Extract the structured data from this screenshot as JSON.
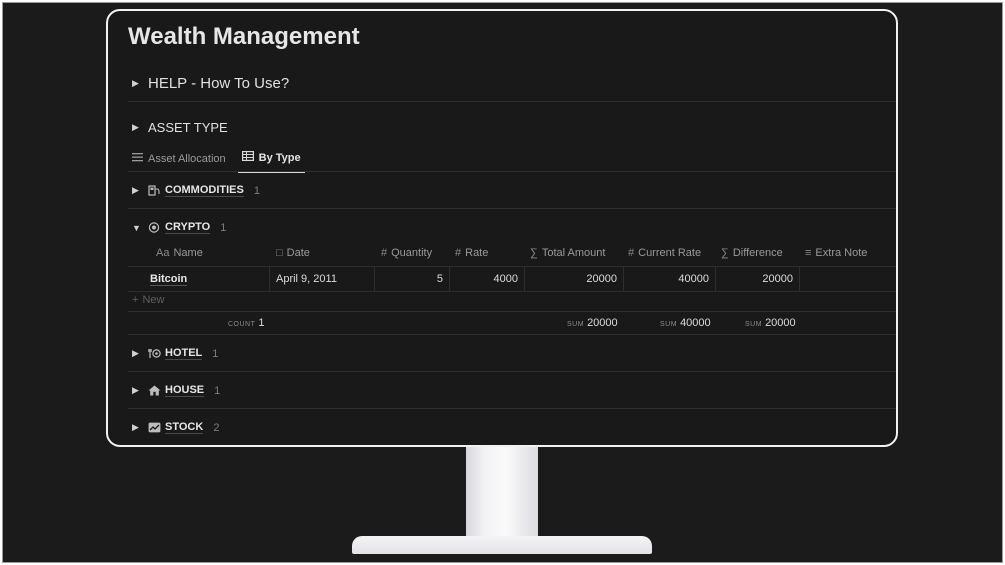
{
  "page": {
    "title": "Wealth Management"
  },
  "toggles": {
    "help": "HELP - How To Use?",
    "asset_type": "ASSET TYPE"
  },
  "tabs": [
    {
      "label": "Asset Allocation",
      "icon": "list-icon",
      "active": false
    },
    {
      "label": "By Type",
      "icon": "table-icon",
      "active": true
    }
  ],
  "groups": {
    "commodities": {
      "label": "COMMODITIES",
      "count": "1",
      "icon": "gas-pump-icon"
    },
    "crypto": {
      "label": "CRYPTO",
      "count": "1",
      "icon": "coin-icon"
    },
    "hotel": {
      "label": "HOTEL",
      "count": "1",
      "icon": "cutlery-icon"
    },
    "house": {
      "label": "HOUSE",
      "count": "1",
      "icon": "house-icon"
    },
    "stock": {
      "label": "STOCK",
      "count": "2",
      "icon": "chart-icon"
    }
  },
  "table": {
    "columns": {
      "name": {
        "label": "Name",
        "icon": "Aa"
      },
      "date": {
        "label": "Date",
        "icon": "calendar-icon"
      },
      "quantity": {
        "label": "Quantity",
        "icon": "#"
      },
      "rate": {
        "label": "Rate",
        "icon": "#"
      },
      "total_amount": {
        "label": "Total Amount",
        "icon": "∑"
      },
      "current_rate": {
        "label": "Current Rate",
        "icon": "#"
      },
      "difference": {
        "label": "Difference",
        "icon": "∑"
      },
      "extra_note": {
        "label": "Extra Note",
        "icon": "lines-icon"
      }
    },
    "rows": [
      {
        "name": "Bitcoin",
        "date": "April 9, 2011",
        "quantity": "5",
        "rate": "4000",
        "total_amount": "20000",
        "current_rate": "40000",
        "difference": "20000",
        "extra_note": ""
      }
    ],
    "new_label": "New",
    "calc": {
      "count_label": "COUNT",
      "count": "1",
      "sum_label": "SUM",
      "total_amount": "20000",
      "current_rate": "40000",
      "difference": "20000"
    }
  },
  "colors": {
    "background": "#191919",
    "text": "#d4d4d4",
    "muted": "#9a9a9a",
    "monitor_frame": "#f2f2f2"
  }
}
